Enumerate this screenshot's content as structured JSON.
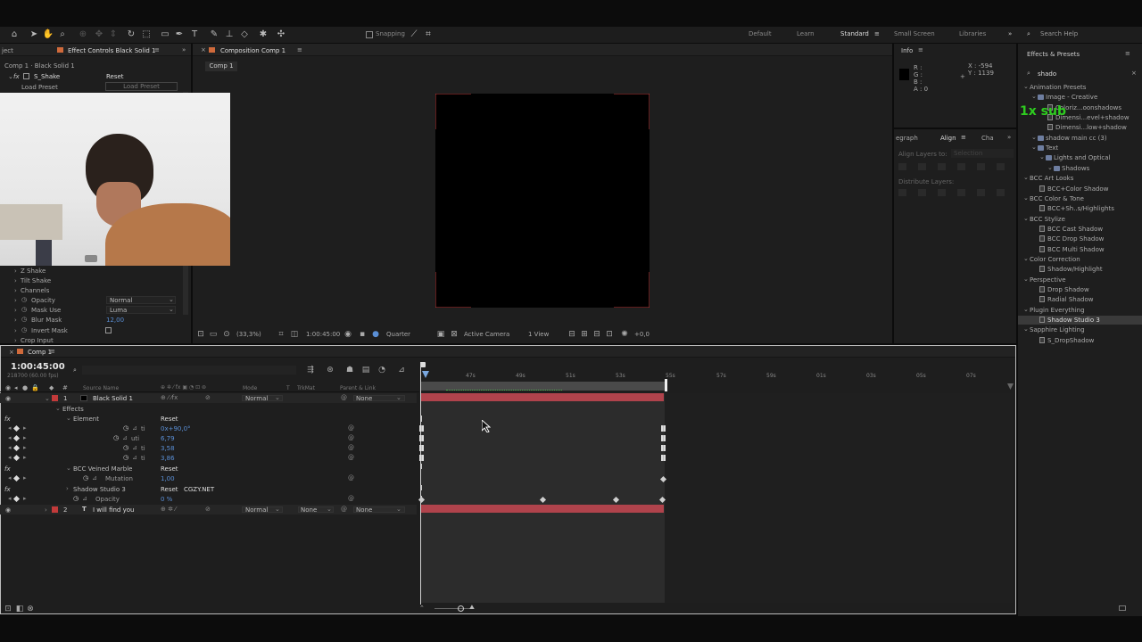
{
  "toolbar": {
    "snapping": "Snapping",
    "workspaces": [
      "Default",
      "Learn",
      "Standard",
      "Small Screen",
      "Libraries"
    ],
    "search_help": "Search Help"
  },
  "effect_controls": {
    "tab_left": "ject",
    "tab": "Effect Controls Black Solid 1",
    "crumb": "Comp 1 · Black Solid 1",
    "fx_name": "S_Shake",
    "reset": "Reset",
    "load_preset": "Load Preset",
    "load_preset_btn": "Load Preset",
    "props": [
      {
        "label": "Z Shake"
      },
      {
        "label": "Tilt Shake"
      },
      {
        "label": "Channels"
      },
      {
        "label": "Opacity",
        "value": "Normal"
      },
      {
        "label": "Mask Use",
        "value": "Luma"
      },
      {
        "label": "Blur Mask",
        "value": "12,00"
      },
      {
        "label": "Invert Mask",
        "value": ""
      },
      {
        "label": "Crop Input",
        "value": ""
      }
    ]
  },
  "composition": {
    "tab": "Composition Comp 1",
    "sub_tab": "Comp 1",
    "zoom": "(33,3%)",
    "timecode": "1:00:45:00",
    "quality": "Quarter",
    "camera": "Active Camera",
    "view": "1 View",
    "exposure": "+0,0"
  },
  "info": {
    "title": "Info",
    "r": "R :",
    "g": "G :",
    "b": "B :",
    "a": "A :  0",
    "x": "X : -594",
    "y": "Y : 1139"
  },
  "align": {
    "tabs": [
      "egraph",
      "Align",
      "Cha"
    ],
    "align_to_label": "Align Layers to:",
    "align_to_value": "Selection",
    "distribute": "Distribute Layers:"
  },
  "effects_presets": {
    "title": "Effects & Presets",
    "search": "shado",
    "overlay": "1x sub",
    "items": [
      {
        "label": "Animation Presets",
        "type": "folder",
        "indent": 0
      },
      {
        "label": "Image - Creative",
        "type": "folder",
        "indent": 1
      },
      {
        "label": "Coloriz...oonshadows",
        "type": "file",
        "indent": 2
      },
      {
        "label": "Dimensi...evel+shadow",
        "type": "file",
        "indent": 2
      },
      {
        "label": "Dimensi...low+shadow",
        "type": "file",
        "indent": 2
      },
      {
        "label": "shadow main cc (3)",
        "type": "folder",
        "indent": 1
      },
      {
        "label": "Text",
        "type": "folder",
        "indent": 1
      },
      {
        "label": "Lights and Optical",
        "type": "folder",
        "indent": 2
      },
      {
        "label": "Shadows",
        "type": "folder",
        "indent": 3
      },
      {
        "label": "BCC Art Looks",
        "type": "folder",
        "indent": 0
      },
      {
        "label": "BCC+Color Shadow",
        "type": "file",
        "indent": 1
      },
      {
        "label": "BCC Color & Tone",
        "type": "folder",
        "indent": 0
      },
      {
        "label": "BCC+Sh..s/Highlights",
        "type": "file",
        "indent": 1
      },
      {
        "label": "BCC Stylize",
        "type": "folder",
        "indent": 0
      },
      {
        "label": "BCC Cast Shadow",
        "type": "file",
        "indent": 1
      },
      {
        "label": "BCC Drop Shadow",
        "type": "file",
        "indent": 1
      },
      {
        "label": "BCC Multi Shadow",
        "type": "file",
        "indent": 1
      },
      {
        "label": "Color Correction",
        "type": "folder",
        "indent": 0
      },
      {
        "label": "Shadow/Highlight",
        "type": "file",
        "indent": 1
      },
      {
        "label": "Perspective",
        "type": "folder",
        "indent": 0
      },
      {
        "label": "Drop Shadow",
        "type": "file",
        "indent": 1
      },
      {
        "label": "Radial Shadow",
        "type": "file",
        "indent": 1
      },
      {
        "label": "Plugin Everything",
        "type": "folder",
        "indent": 0
      },
      {
        "label": "Shadow Studio 3",
        "type": "file",
        "indent": 1
      },
      {
        "label": "Sapphire Lighting",
        "type": "folder",
        "indent": 0
      },
      {
        "label": "S_DropShadow",
        "type": "file",
        "indent": 1
      }
    ]
  },
  "timeline": {
    "tab": "Comp 1",
    "timecode": "1:00:45:00",
    "fps": "218700 (60.00 fps)",
    "col_source": "Source Name",
    "col_mode": "Mode",
    "col_t": "T",
    "col_trkmat": "TrkMat",
    "col_parent": "Parent & Link",
    "ticks": [
      "47s",
      "49s",
      "51s",
      "53s",
      "55s",
      "57s",
      "59s",
      "01s",
      "03s",
      "05s",
      "07s"
    ],
    "rows": [
      {
        "num": "1",
        "name": "Black Solid 1",
        "mode": "Normal",
        "parent": "None"
      },
      {
        "name": "Effects"
      },
      {
        "name": "Element",
        "reset": "Reset"
      },
      {
        "name": "ti",
        "value": "0x+90,0°"
      },
      {
        "name": "uti",
        "value": "6,79"
      },
      {
        "name": "ti",
        "value": "3,58"
      },
      {
        "name": "ti",
        "value": "3,86"
      },
      {
        "name": "BCC Veined Marble",
        "reset": "Reset"
      },
      {
        "name": "Mutation",
        "value": "1,00"
      },
      {
        "name": "Shadow Studio 3",
        "reset": "Reset",
        "extra": "CGZY.NET"
      },
      {
        "name": "Opacity",
        "value": "0 %"
      },
      {
        "num": "2",
        "name": "I will find you",
        "mode": "Normal",
        "trkmat": "None",
        "parent": "None"
      }
    ]
  }
}
